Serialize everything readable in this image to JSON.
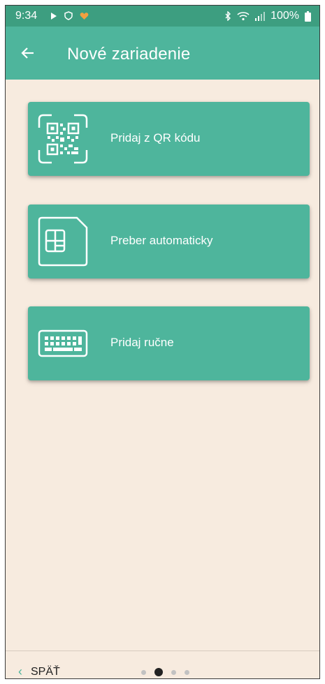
{
  "status_bar": {
    "time": "9:34",
    "battery": "100%",
    "left_icons": [
      "play-icon",
      "shield-icon",
      "heart-icon"
    ],
    "right_icons": [
      "bluetooth-icon",
      "wifi-icon",
      "signal-icon",
      "battery-icon"
    ]
  },
  "app_bar": {
    "title": "Nové zariadenie",
    "back_icon": "arrow-left-icon"
  },
  "options": [
    {
      "label": "Pridaj z QR kódu",
      "icon": "qr-code-icon"
    },
    {
      "label": "Preber automaticky",
      "icon": "sim-card-icon"
    },
    {
      "label": "Pridaj ručne",
      "icon": "keyboard-icon"
    }
  ],
  "bottom_bar": {
    "back_label": "SPÄŤ",
    "pages_total": 4,
    "active_page": 2
  },
  "colors": {
    "status_bar": "#3d9e80",
    "primary": "#4eb59c",
    "background": "#f7ebdf"
  }
}
